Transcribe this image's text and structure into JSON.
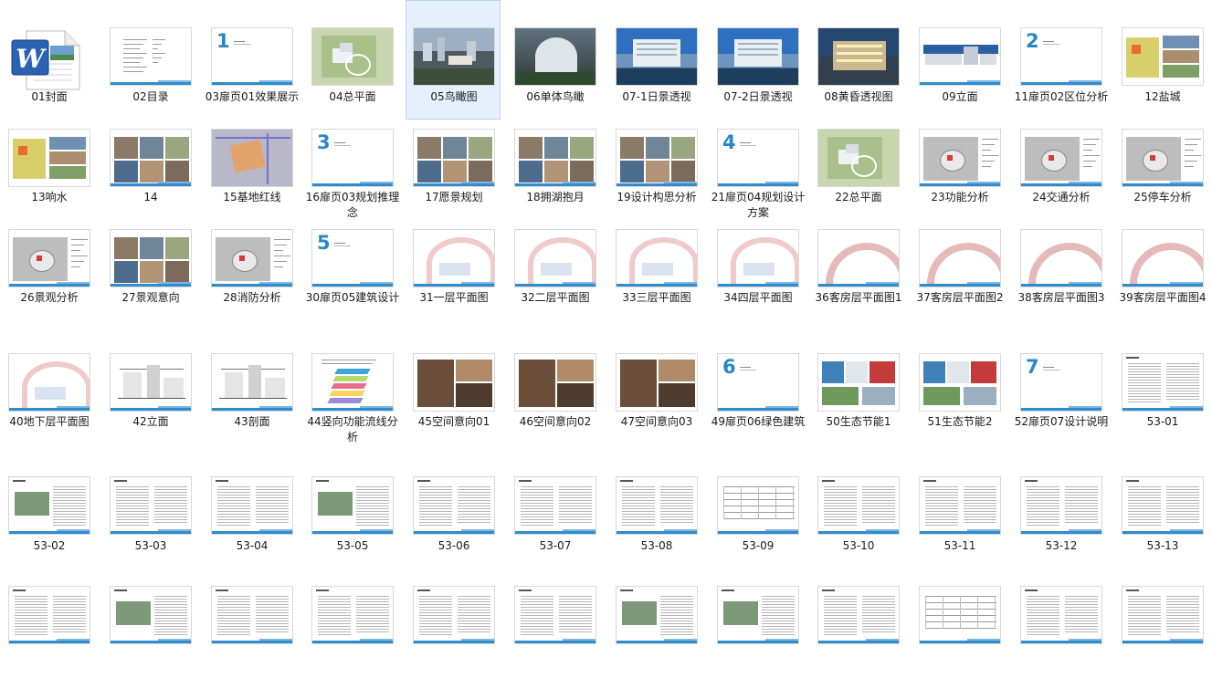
{
  "folder_view": {
    "items": [
      {
        "label": "01封面",
        "kind": "wordfile"
      },
      {
        "label": "02目录",
        "kind": "toc"
      },
      {
        "label": "03扉页01效果展示",
        "kind": "divider",
        "num": "1"
      },
      {
        "label": "04总平面",
        "kind": "siteplan"
      },
      {
        "label": "05鸟瞰图",
        "kind": "aerial",
        "selected": true
      },
      {
        "label": "06单体鸟瞰",
        "kind": "aerial2"
      },
      {
        "label": "07-1日景透视",
        "kind": "day"
      },
      {
        "label": "07-2日景透视",
        "kind": "day"
      },
      {
        "label": "08黄昏透视图",
        "kind": "dusk"
      },
      {
        "label": "09立面",
        "kind": "elevation"
      },
      {
        "label": "11扉页02区位分析",
        "kind": "divider",
        "num": "2"
      },
      {
        "label": "12盐城",
        "kind": "mapphotos"
      },
      {
        "label": "13响水",
        "kind": "mapphotos"
      },
      {
        "label": "14",
        "kind": "photogrid"
      },
      {
        "label": "15基地红线",
        "kind": "redline"
      },
      {
        "label": "16扉页03规划推理念",
        "kind": "divider",
        "num": "3"
      },
      {
        "label": "17愿景规划",
        "kind": "photogrid"
      },
      {
        "label": "18拥湖抱月",
        "kind": "photogrid"
      },
      {
        "label": "19设计构思分析",
        "kind": "photogrid"
      },
      {
        "label": "21扉页04规划设计方案",
        "kind": "divider",
        "num": "4"
      },
      {
        "label": "22总平面",
        "kind": "siteplan"
      },
      {
        "label": "23功能分析",
        "kind": "analysis"
      },
      {
        "label": "24交通分析",
        "kind": "analysis"
      },
      {
        "label": "25停车分析",
        "kind": "analysis"
      },
      {
        "label": "26景观分析",
        "kind": "analysis"
      },
      {
        "label": "27景观意向",
        "kind": "photogrid"
      },
      {
        "label": "28消防分析",
        "kind": "analysis"
      },
      {
        "label": "30扉页05建筑设计",
        "kind": "divider",
        "num": "5"
      },
      {
        "label": "31一层平面图",
        "kind": "floorplan"
      },
      {
        "label": "32二层平面图",
        "kind": "floorplan"
      },
      {
        "label": "33三层平面图",
        "kind": "floorplan"
      },
      {
        "label": "34四层平面图",
        "kind": "floorplan"
      },
      {
        "label": "36客房层平面图1",
        "kind": "arcplan"
      },
      {
        "label": "37客房层平面图2",
        "kind": "arcplan"
      },
      {
        "label": "38客房层平面图3",
        "kind": "arcplan"
      },
      {
        "label": "39客房层平面图4",
        "kind": "arcplan"
      },
      {
        "label": "40地下层平面图",
        "kind": "basement"
      },
      {
        "label": "42立面",
        "kind": "drawing"
      },
      {
        "label": "43剖面",
        "kind": "drawing"
      },
      {
        "label": "44竖向功能流线分析",
        "kind": "diagram"
      },
      {
        "label": "45空间意向01",
        "kind": "interior"
      },
      {
        "label": "46空间意向02",
        "kind": "interior"
      },
      {
        "label": "47空间意向03",
        "kind": "interior"
      },
      {
        "label": "49扉页06绿色建筑",
        "kind": "divider",
        "num": "6"
      },
      {
        "label": "50生态节能1",
        "kind": "eco"
      },
      {
        "label": "51生态节能2",
        "kind": "eco"
      },
      {
        "label": "52扉页07设计说明",
        "kind": "divider",
        "num": "7"
      },
      {
        "label": "53-01",
        "kind": "text"
      },
      {
        "label": "53-02",
        "kind": "textimg"
      },
      {
        "label": "53-03",
        "kind": "text"
      },
      {
        "label": "53-04",
        "kind": "text"
      },
      {
        "label": "53-05",
        "kind": "textimg"
      },
      {
        "label": "53-06",
        "kind": "text"
      },
      {
        "label": "53-07",
        "kind": "text"
      },
      {
        "label": "53-08",
        "kind": "text"
      },
      {
        "label": "53-09",
        "kind": "table"
      },
      {
        "label": "53-10",
        "kind": "text"
      },
      {
        "label": "53-11",
        "kind": "text"
      },
      {
        "label": "53-12",
        "kind": "text"
      },
      {
        "label": "53-13",
        "kind": "text"
      },
      {
        "label": "",
        "kind": "text"
      },
      {
        "label": "",
        "kind": "textimg"
      },
      {
        "label": "",
        "kind": "text"
      },
      {
        "label": "",
        "kind": "text"
      },
      {
        "label": "",
        "kind": "text"
      },
      {
        "label": "",
        "kind": "text"
      },
      {
        "label": "",
        "kind": "textimg"
      },
      {
        "label": "",
        "kind": "textimg"
      },
      {
        "label": "",
        "kind": "text"
      },
      {
        "label": "",
        "kind": "table"
      },
      {
        "label": "",
        "kind": "text"
      },
      {
        "label": "",
        "kind": "text"
      }
    ]
  },
  "icons": {
    "word_app": "word-document-icon"
  },
  "colors": {
    "selection_bg": "#e6f0fb",
    "selection_border": "#b9d4ef",
    "accent": "#2f8ccf"
  }
}
